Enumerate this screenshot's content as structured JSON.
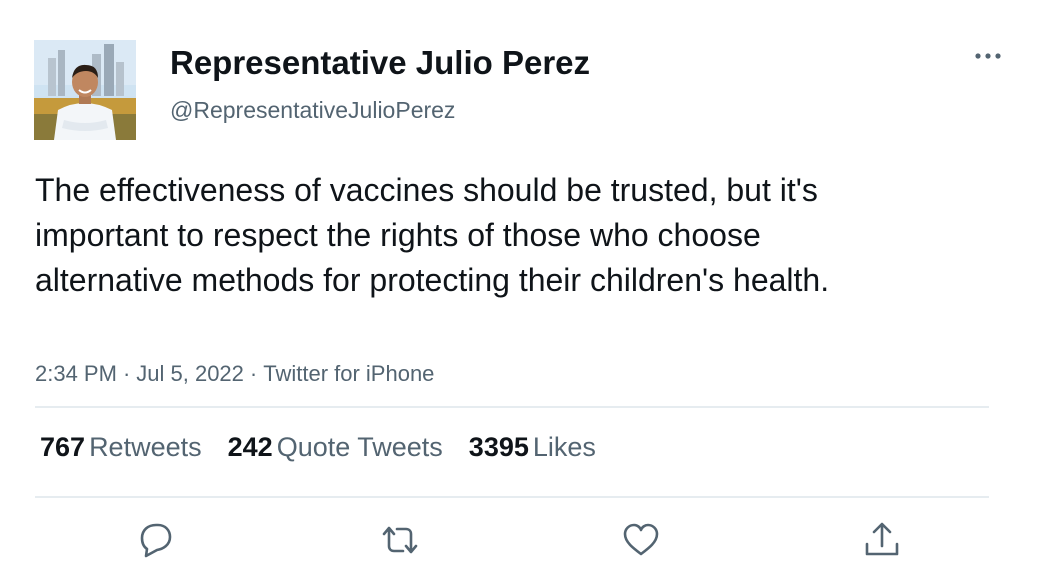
{
  "tweet": {
    "author": {
      "display_name": "Representative Julio Perez",
      "handle": "@RepresentativeJulioPerez"
    },
    "text": "The effectiveness of vaccines should be trusted, but it's important to respect the rights of those who choose alternative methods for protecting their children's health.",
    "time": "2:34 PM",
    "separator": "·",
    "date": "Jul 5, 2022",
    "source": "Twitter for iPhone",
    "stats": {
      "retweets_count": "767",
      "retweets_label": "Retweets",
      "quotes_count": "242",
      "quotes_label": "Quote Tweets",
      "likes_count": "3395",
      "likes_label": "Likes"
    }
  },
  "icons": {
    "more": "more-icon",
    "reply": "reply-icon",
    "retweet": "retweet-icon",
    "like": "like-icon",
    "share": "share-icon"
  },
  "colors": {
    "text": "#0f1419",
    "secondary": "#536471",
    "divider": "#e6ecf0"
  }
}
